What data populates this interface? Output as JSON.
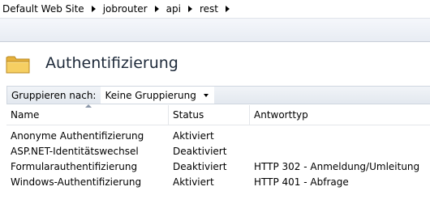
{
  "breadcrumb": [
    "Default Web Site",
    "jobrouter",
    "api",
    "rest"
  ],
  "header": {
    "title": "Authentifizierung",
    "icon": "folder-icon"
  },
  "grouping": {
    "label": "Gruppieren nach:",
    "value": "Keine Gruppierung"
  },
  "table": {
    "columns": [
      "Name",
      "Status",
      "Antworttyp"
    ],
    "rows": [
      {
        "name": "Anonyme Authentifizierung",
        "status": "Aktiviert",
        "response": ""
      },
      {
        "name": "ASP.NET-Identitätswechsel",
        "status": "Deaktiviert",
        "response": ""
      },
      {
        "name": "Formularauthentifizierung",
        "status": "Deaktiviert",
        "response": "HTTP 302 - Anmeldung/Umleitung"
      },
      {
        "name": "Windows-Authentifizierung",
        "status": "Aktiviert",
        "response": "HTTP 401 - Abfrage"
      }
    ]
  },
  "colors": {
    "folder": "#f1c453",
    "title": "#1e2a3a"
  }
}
